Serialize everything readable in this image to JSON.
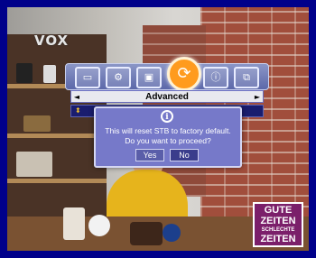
{
  "channel_logo": "VOX",
  "program_logo": {
    "line1": "GUTE",
    "line2": "ZEITEN",
    "line3": "SCHLECHTE",
    "line4": "ZEITEN"
  },
  "osd": {
    "icons": [
      "tv-setup-icon",
      "settings-icon",
      "display-icon",
      "system-refresh-icon",
      "info-icon",
      "network-icon"
    ],
    "selected_icon_index": 3,
    "menu_title": "Advanced",
    "left_arrow": "◄",
    "right_arrow": "►",
    "row_arrow": "⬍"
  },
  "dialog": {
    "icon_glyph": "i",
    "message_line1": "This will reset STB to factory default.",
    "message_line2": "Do you want to proceed?",
    "yes_label": "Yes",
    "no_label": "No"
  },
  "colors": {
    "frame": "#00008a",
    "menu_accent": "#7679c9",
    "selected_icon": "#ff9b1e"
  }
}
